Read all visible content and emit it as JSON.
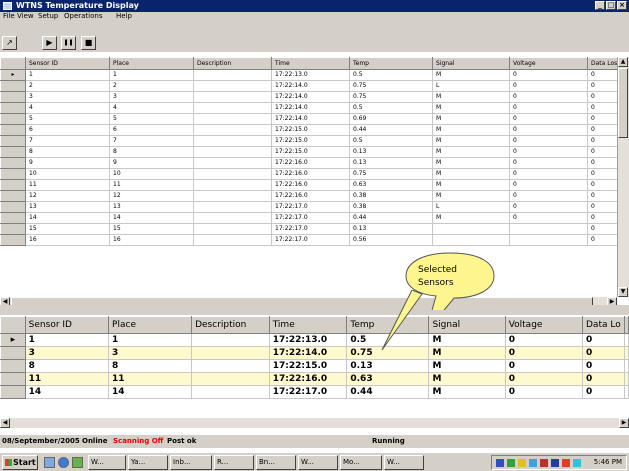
{
  "window": {
    "title": "WTNS Temperature Display",
    "controls": [
      "_",
      "□",
      "×"
    ]
  },
  "menu": [
    "File",
    "View",
    "Setup",
    "Operations",
    "Help"
  ],
  "toolbar": {
    "buttons": [
      {
        "name": "graph-button",
        "glyph": "↗"
      },
      {
        "name": "play-button",
        "glyph": "▶"
      },
      {
        "name": "pause-button",
        "glyph": "❚❚"
      },
      {
        "name": "stop-button",
        "glyph": "■"
      }
    ]
  },
  "upper_grid": {
    "columns": [
      "Sensor ID",
      "Place",
      "Description",
      "Time",
      "Temp",
      "Signal",
      "Voltage",
      "Data Los"
    ],
    "current_indicator": "▸",
    "rows": [
      [
        "1",
        "1",
        "",
        "17:22:13.0",
        "0.5",
        "M",
        "0",
        "0"
      ],
      [
        "2",
        "2",
        "",
        "17:22:14.0",
        "0.75",
        "L",
        "0",
        "0"
      ],
      [
        "3",
        "3",
        "",
        "17:22:14.0",
        "0.75",
        "M",
        "0",
        "0"
      ],
      [
        "4",
        "4",
        "",
        "17:22:14.0",
        "0.5",
        "M",
        "0",
        "0"
      ],
      [
        "5",
        "5",
        "",
        "17:22:14.0",
        "0.69",
        "M",
        "0",
        "0"
      ],
      [
        "6",
        "6",
        "",
        "17:22:15.0",
        "0.44",
        "M",
        "0",
        "0"
      ],
      [
        "7",
        "7",
        "",
        "17:22:15.0",
        "0.5",
        "M",
        "0",
        "0"
      ],
      [
        "8",
        "8",
        "",
        "17:22:15.0",
        "0.13",
        "M",
        "0",
        "0"
      ],
      [
        "9",
        "9",
        "",
        "17:22:16.0",
        "0.13",
        "M",
        "0",
        "0"
      ],
      [
        "10",
        "10",
        "",
        "17:22:16.0",
        "0.75",
        "M",
        "0",
        "0"
      ],
      [
        "11",
        "11",
        "",
        "17:22:16.0",
        "0.63",
        "M",
        "0",
        "0"
      ],
      [
        "12",
        "12",
        "",
        "17:22:16.0",
        "0.38",
        "M",
        "0",
        "0"
      ],
      [
        "13",
        "13",
        "",
        "17:22:17.0",
        "0.38",
        "L",
        "0",
        "0"
      ],
      [
        "14",
        "14",
        "",
        "17:22:17.0",
        "0.44",
        "M",
        "0",
        "0"
      ],
      [
        "15",
        "15",
        "",
        "17:22:17.0",
        "0.13",
        "",
        "",
        "0"
      ],
      [
        "16",
        "16",
        "",
        "17:22:17.0",
        "0.56",
        "",
        "",
        "0"
      ]
    ]
  },
  "lower_grid": {
    "columns": [
      "Sensor ID",
      "Place",
      "Description",
      "Time",
      "Temp",
      "Signal",
      "Voltage",
      "Data Lo"
    ],
    "current_indicator": "▸",
    "rows": [
      [
        "1",
        "1",
        "",
        "17:22:13.0",
        "0.5",
        "M",
        "0",
        "0"
      ],
      [
        "3",
        "3",
        "",
        "17:22:14.0",
        "0.75",
        "M",
        "0",
        "0"
      ],
      [
        "8",
        "8",
        "",
        "17:22:15.0",
        "0.13",
        "M",
        "0",
        "0"
      ],
      [
        "11",
        "11",
        "",
        "17:22:16.0",
        "0.63",
        "M",
        "0",
        "0"
      ],
      [
        "14",
        "14",
        "",
        "17:22:17.0",
        "0.44",
        "M",
        "0",
        "0"
      ]
    ]
  },
  "callout": {
    "line1": "Selected",
    "line2": "Sensors",
    "color": "#fff68f"
  },
  "scroll": {
    "left": "◀",
    "right": "▶",
    "up": "▲",
    "down": "▼"
  },
  "status": {
    "date": "08/September/2005",
    "connection": "Online",
    "scanning": "Scanning Off",
    "post": "Post ok",
    "state": "Running",
    "scanning_color": "#e00000"
  },
  "taskbar": {
    "start": "Start",
    "tasks": [
      "W...",
      "Ya...",
      "Inb...",
      "R...",
      "Bn...",
      "W...",
      "Mo...",
      "W..."
    ],
    "clock": "5:46 PM"
  },
  "colors": {
    "titlebar": "#08246b",
    "highlight_row": "#fffacd",
    "face": "#d4d0c8"
  }
}
